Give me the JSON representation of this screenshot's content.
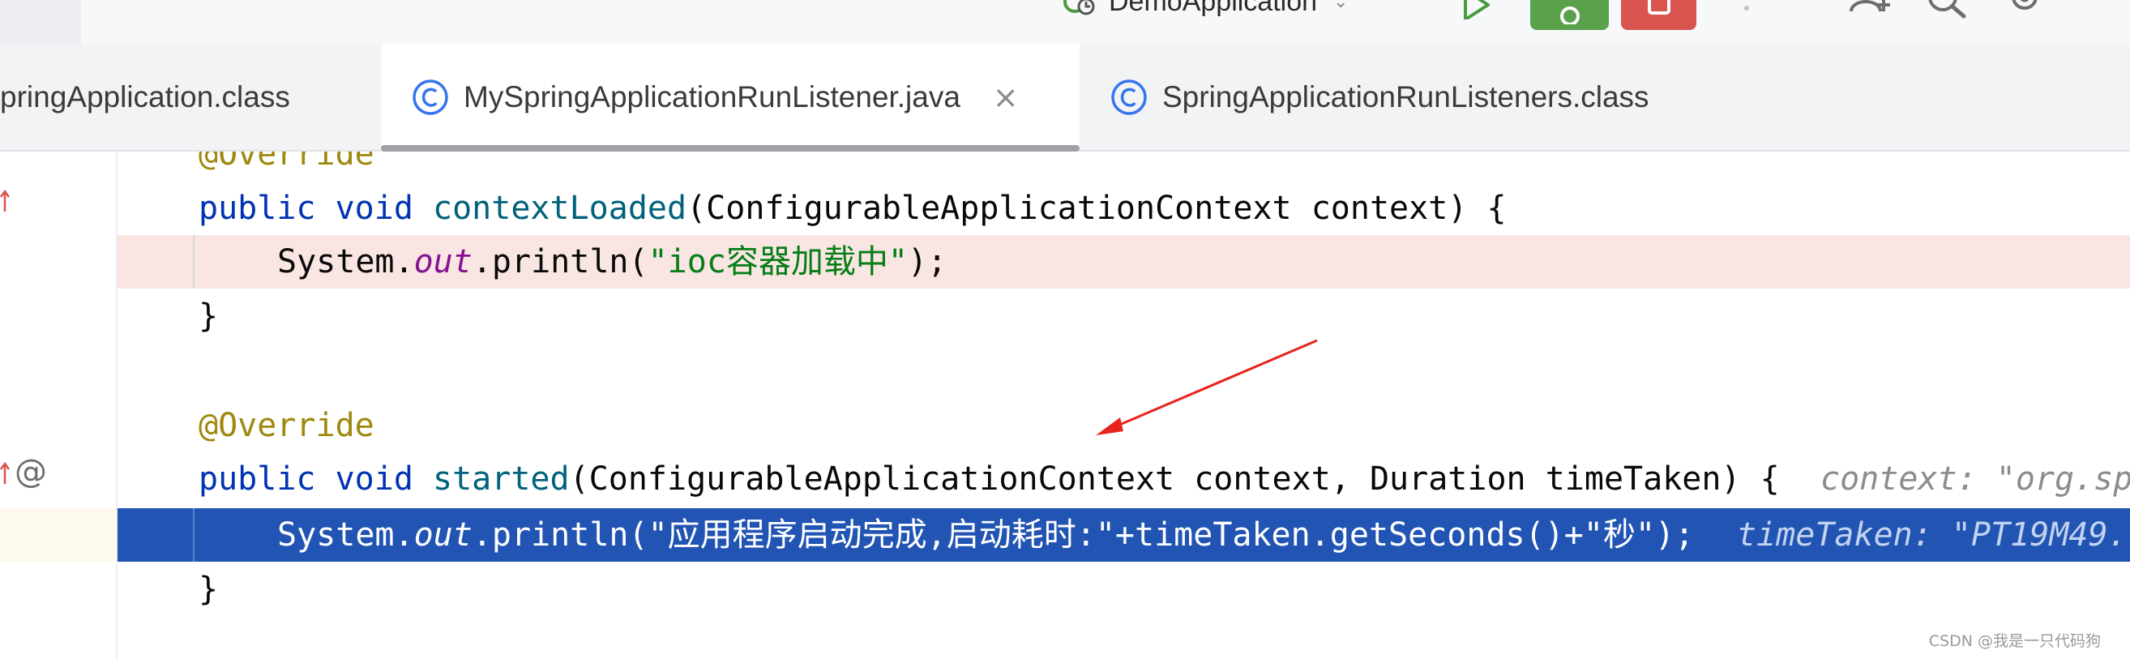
{
  "toolbar": {
    "run_config_label": "DemoApplication",
    "run_config_caret": "⌄"
  },
  "tabs": [
    {
      "label": "pringApplication.class",
      "active": false
    },
    {
      "label": "MySpringApplicationRunListener.java",
      "active": true,
      "close": "×"
    },
    {
      "label": "SpringApplicationRunListeners.class",
      "active": false
    }
  ],
  "editor": {
    "lines": [
      {
        "ann": "@Override"
      },
      {
        "kw1": "public",
        "kw2": "void",
        "fn": "contextLoaded",
        "rest": "(ConfigurableApplicationContext context) {"
      },
      {
        "obj": "System.",
        "field": "out",
        "call": ".println(",
        "str": "\"ioc容器加载中\"",
        "end": ");"
      },
      {
        "text": "}"
      },
      {
        "ann": "@Override"
      },
      {
        "kw1": "public",
        "kw2": "void",
        "fn": "started",
        "rest": "(ConfigurableApplicationContext context, Duration timeTaken) {",
        "hint": "context: \"org.sp"
      },
      {
        "obj": "System.",
        "field": "out",
        "call": ".println(",
        "rest": "\"应用程序启动完成,启动耗时:\"+timeTaken.getSeconds()+\"秒\");",
        "hint": "timeTaken: \"PT19M49."
      },
      {
        "text": "}"
      }
    ],
    "gutter_at": "@"
  },
  "watermark": "CSDN @我是一只代码狗",
  "colors": {
    "keyword": "#0033b3",
    "method": "#00627a",
    "annotation": "#9e880d",
    "string": "#067d17",
    "field": "#871094",
    "selection": "#2154b3",
    "breakpoint_line": "#f9e6e3",
    "arrow": "#e8231c"
  }
}
